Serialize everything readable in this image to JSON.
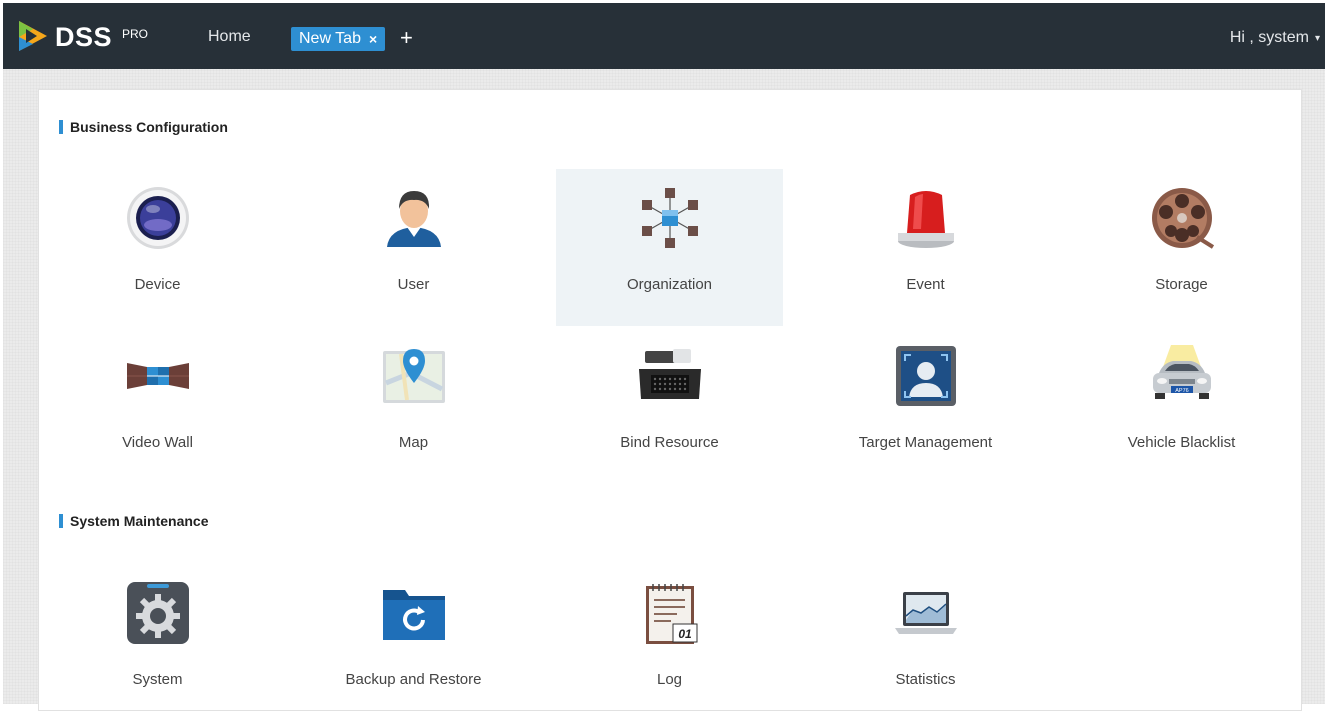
{
  "header": {
    "brand": "DSS",
    "brand_suffix": "PRO",
    "nav_home": "Home",
    "active_tab": "New Tab",
    "tab_close": "×",
    "tab_add": "+",
    "greeting": "Hi , system",
    "caret": "▾"
  },
  "sections": {
    "business": {
      "title": "Business Configuration",
      "items": [
        {
          "label": "Device",
          "icon": "device-icon"
        },
        {
          "label": "User",
          "icon": "user-icon"
        },
        {
          "label": "Organization",
          "icon": "organization-icon"
        },
        {
          "label": "Event",
          "icon": "event-alarm-icon"
        },
        {
          "label": "Storage",
          "icon": "storage-film-reel-icon"
        },
        {
          "label": "Video Wall",
          "icon": "video-wall-icon"
        },
        {
          "label": "Map",
          "icon": "map-pin-icon"
        },
        {
          "label": "Bind Resource",
          "icon": "bind-resource-icon"
        },
        {
          "label": "Target Management",
          "icon": "target-management-icon"
        },
        {
          "label": "Vehicle Blacklist",
          "icon": "vehicle-icon"
        }
      ]
    },
    "maintenance": {
      "title": "System Maintenance",
      "items": [
        {
          "label": "System",
          "icon": "system-gear-icon"
        },
        {
          "label": "Backup and Restore",
          "icon": "backup-folder-icon"
        },
        {
          "label": "Log",
          "icon": "log-notepad-icon"
        },
        {
          "label": "Statistics",
          "icon": "statistics-laptop-icon"
        }
      ]
    }
  },
  "log_icon_text": "01",
  "vehicle_plate_text": "AP76",
  "colors": {
    "topbar": "#273038",
    "accent": "#2e8fd2",
    "selected_tile": "#eef3f6"
  }
}
